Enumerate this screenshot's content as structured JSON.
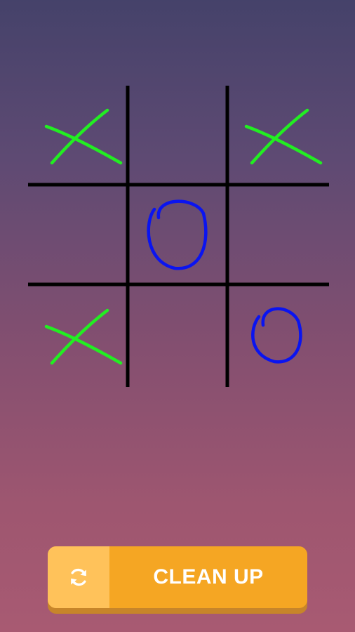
{
  "board": {
    "cells": [
      "X",
      "",
      "X",
      "",
      "O",
      "",
      "X",
      "",
      "O"
    ]
  },
  "colors": {
    "grid": "#000000",
    "x_mark": "#22ee22",
    "o_mark": "#0a14f0",
    "button": "#f5a623",
    "button_icon_bg": "#ffc25a",
    "button_shadow": "#c7852a"
  },
  "clean_button": {
    "label": "CLEAN UP",
    "icon": "refresh-icon"
  }
}
